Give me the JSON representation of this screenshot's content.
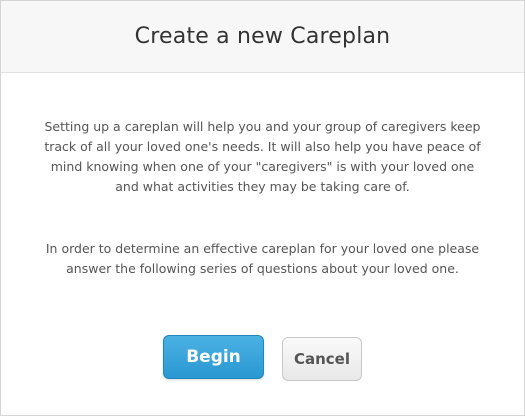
{
  "modal": {
    "title": "Create a new Careplan",
    "paragraph_1": "Setting up a careplan will help you and your group of caregivers keep track of all your loved one's needs. It will also help you have peace of mind knowing when one of your \"caregivers\" is with your loved one and what activities they may be taking care of.",
    "paragraph_2": "In order to determine an effective careplan for your loved one please answer the following series of questions about your loved one.",
    "begin_label": "Begin",
    "cancel_label": "Cancel"
  },
  "colors": {
    "primary": "#2a98d2",
    "header_bg": "#f7f7f7"
  }
}
